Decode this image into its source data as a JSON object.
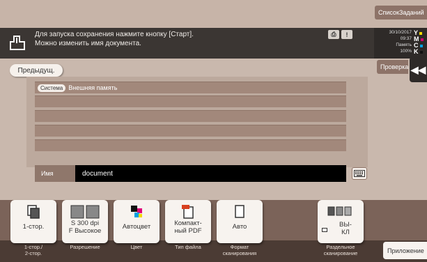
{
  "header": {
    "job_list_label": "СписокЗаданий",
    "message_line1": "Для запуска сохранения нажмите кнопку [Старт].",
    "message_line2": "Можно изменить имя документа.",
    "date": "30/10/2017",
    "time": "09:37",
    "memory_label": "Память",
    "memory_value": "100%",
    "toner": [
      "Y",
      "M",
      "C",
      "K"
    ],
    "toner_colors": [
      "#f5d800",
      "#d4006f",
      "#00a0e0",
      "#111111"
    ]
  },
  "nav": {
    "prev_label": "Предыдущ.",
    "check_label": "Проверка",
    "collapse_glyph": "◀◀"
  },
  "list": {
    "tag": "Система",
    "destination": "Внешняя память"
  },
  "name_field": {
    "label": "Имя",
    "value": "document"
  },
  "functions": [
    {
      "label": "1-стор.",
      "caption": "1-стор./\n2-стор."
    },
    {
      "label": "S 300 dpi\nF Высокое",
      "caption": "Разрешение"
    },
    {
      "label": "Автоцвет",
      "caption": "Цвет"
    },
    {
      "label": "Компакт-\nный PDF",
      "caption": "Тип файла"
    },
    {
      "label": "Авто",
      "caption": "Формат\nсканирования"
    },
    {
      "label": "ВЫ-\nКЛ",
      "caption": "Раздельное\nсканирование"
    }
  ],
  "apps_label": "Приложение",
  "colors": {
    "accent_dark": "#3b3633",
    "panel": "#a2887b",
    "button_face": "#f7f3ef"
  }
}
